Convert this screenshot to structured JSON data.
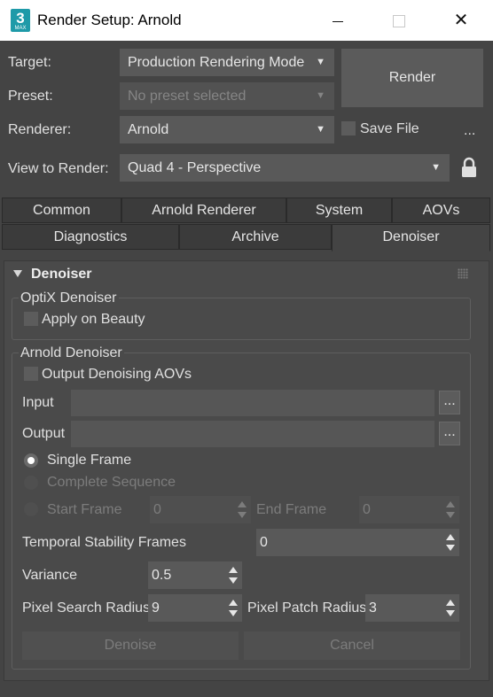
{
  "window": {
    "title": "Render Setup: Arnold",
    "app_icon_glyph": "3",
    "app_icon_sub": "MAX",
    "close_glyph": "✕",
    "icons": [
      "app-icon",
      "minimize-icon",
      "maximize-icon",
      "close-icon",
      "lock-icon",
      "dropdown-arrow-icon",
      "spinner-arrows-icon",
      "rollout-collapse-icon",
      "grip-icon"
    ]
  },
  "top": {
    "target_label": "Target:",
    "target_value": "Production Rendering Mode",
    "preset_label": "Preset:",
    "preset_value": "No preset selected",
    "renderer_label": "Renderer:",
    "renderer_value": "Arnold",
    "view_label": "View to Render:",
    "view_value": "Quad 4 - Perspective",
    "render_button": "Render",
    "save_file_label": "Save File",
    "more_button": "...",
    "arrow_glyph": "▼"
  },
  "tabs": {
    "row1": [
      "Common",
      "Arnold Renderer",
      "System",
      "AOVs"
    ],
    "row2": [
      "Diagnostics",
      "Archive",
      "Denoiser"
    ],
    "active": "Denoiser"
  },
  "denoiser": {
    "rollout_title": "Denoiser",
    "optix": {
      "title": "OptiX Denoiser",
      "apply_on_beauty": "Apply on Beauty"
    },
    "arnold": {
      "title": "Arnold Denoiser",
      "output_aovs": "Output Denoising AOVs",
      "input_label": "Input",
      "input_value": "",
      "output_label": "Output",
      "output_value": "",
      "browse_label": "...",
      "single_frame": "Single Frame",
      "complete_sequence": "Complete Sequence",
      "start_frame_label": "Start Frame",
      "start_frame_value": "0",
      "end_frame_label": "End Frame",
      "end_frame_value": "0",
      "temporal_label": "Temporal Stability Frames",
      "temporal_value": "0",
      "variance_label": "Variance",
      "variance_value": "0.5",
      "pixel_search_label": "Pixel Search Radius",
      "pixel_search_value": "9",
      "pixel_patch_label": "Pixel Patch Radius",
      "pixel_patch_value": "3",
      "denoise_button": "Denoise",
      "cancel_button": "Cancel"
    }
  }
}
